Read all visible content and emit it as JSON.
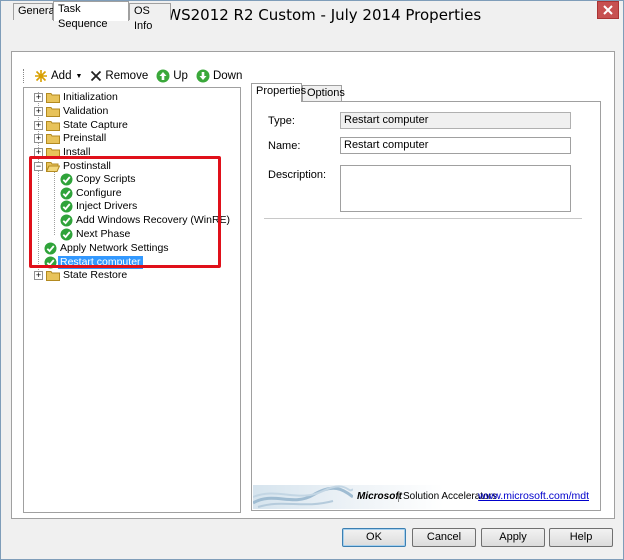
{
  "window": {
    "title": "TS WS2012 R2 Custom - July 2014 Properties"
  },
  "tabs": [
    {
      "label": "General"
    },
    {
      "label": "Task Sequence"
    },
    {
      "label": "OS Info"
    }
  ],
  "toolbar": {
    "add": "Add",
    "remove": "Remove",
    "up": "Up",
    "down": "Down"
  },
  "tree": {
    "items": [
      {
        "label": "Initialization",
        "type": "folder",
        "expander": "+"
      },
      {
        "label": "Validation",
        "type": "folder",
        "expander": "+"
      },
      {
        "label": "State Capture",
        "type": "folder",
        "expander": "+"
      },
      {
        "label": "Preinstall",
        "type": "folder",
        "expander": "+"
      },
      {
        "label": "Install",
        "type": "folder",
        "expander": "+"
      },
      {
        "label": "Postinstall",
        "type": "folder",
        "expander": "−"
      },
      {
        "label": "Copy Scripts",
        "type": "step"
      },
      {
        "label": "Configure",
        "type": "step"
      },
      {
        "label": "Inject Drivers",
        "type": "step"
      },
      {
        "label": "Add Windows Recovery (WinRE)",
        "type": "step"
      },
      {
        "label": "Next Phase",
        "type": "step"
      },
      {
        "label": "Apply Network Settings",
        "type": "step"
      },
      {
        "label": "Restart computer",
        "type": "step",
        "selected": true
      },
      {
        "label": "State Restore",
        "type": "folder",
        "expander": "+"
      }
    ]
  },
  "details": {
    "tabs": [
      {
        "label": "Properties"
      },
      {
        "label": "Options"
      }
    ],
    "type_label": "Type:",
    "type_value": "Restart computer",
    "name_label": "Name:",
    "name_value": "Restart computer",
    "description_label": "Description:",
    "description_value": ""
  },
  "banner": {
    "brand": "Microsoft",
    "product": "Solution Accelerators",
    "link": "www.microsoft.com/mdt"
  },
  "buttons": {
    "ok": "OK",
    "cancel": "Cancel",
    "apply": "Apply",
    "help": "Help"
  },
  "colors": {
    "selection": "#3399ff",
    "highlight_box": "#e0101a",
    "check_green": "#2fa33a",
    "folder_yellow": "#e8c35a"
  }
}
